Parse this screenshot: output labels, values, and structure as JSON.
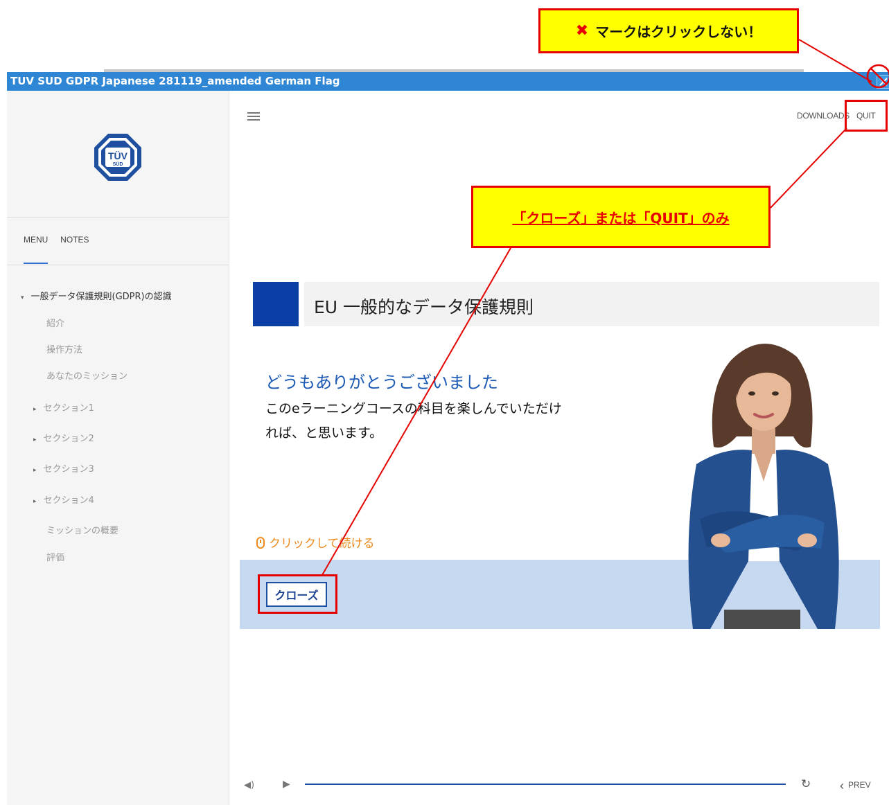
{
  "window": {
    "title": "TUV SUD GDPR Japanese 281119_amended German Flag"
  },
  "logo": {
    "text_top": "TÜV",
    "text_bottom": "SÜD"
  },
  "sidebar": {
    "tabs": [
      "MENU",
      "NOTES"
    ],
    "menu": [
      {
        "label": "一般データ保護規則(GDPR)の認識",
        "level": "main",
        "arrow": "▾"
      },
      {
        "label": "紹介",
        "level": "sub",
        "arrow": ""
      },
      {
        "label": "操作方法",
        "level": "sub",
        "arrow": ""
      },
      {
        "label": "あなたのミッション",
        "level": "sub",
        "arrow": ""
      },
      {
        "label": "セクション1",
        "level": "section",
        "arrow": "▸"
      },
      {
        "label": "セクション2",
        "level": "section",
        "arrow": "▸"
      },
      {
        "label": "セクション3",
        "level": "section",
        "arrow": "▸"
      },
      {
        "label": "セクション4",
        "level": "section",
        "arrow": "▸"
      },
      {
        "label": "ミッションの概要",
        "level": "sub",
        "arrow": ""
      },
      {
        "label": "評価",
        "level": "sub",
        "arrow": ""
      }
    ]
  },
  "topbar": {
    "downloads": "DOWNLOADS",
    "quit": "QUIT"
  },
  "slide": {
    "title": "EU 一般的なデータ保護規則",
    "thanks": "どうもありがとうございました",
    "body_line1": "このeラーニングコースの科目を楽しんでいただけ",
    "body_line2": "れば、と思います。",
    "click_hint": "クリックして続ける",
    "close_button": "クローズ"
  },
  "player": {
    "prev": "PREV",
    "progress": 1.0
  },
  "annotations": {
    "top_callout_mark": "✖",
    "top_callout": "マークはクリックしない！",
    "mid_callout": "「クローズ」または「QUIT」のみ"
  },
  "colors": {
    "titlebar": "#2e86d4",
    "accent_blue": "#0a3fa6",
    "annotation_red": "#e60000",
    "annotation_yellow": "#ffff00",
    "hint_orange": "#ec8a1c"
  }
}
